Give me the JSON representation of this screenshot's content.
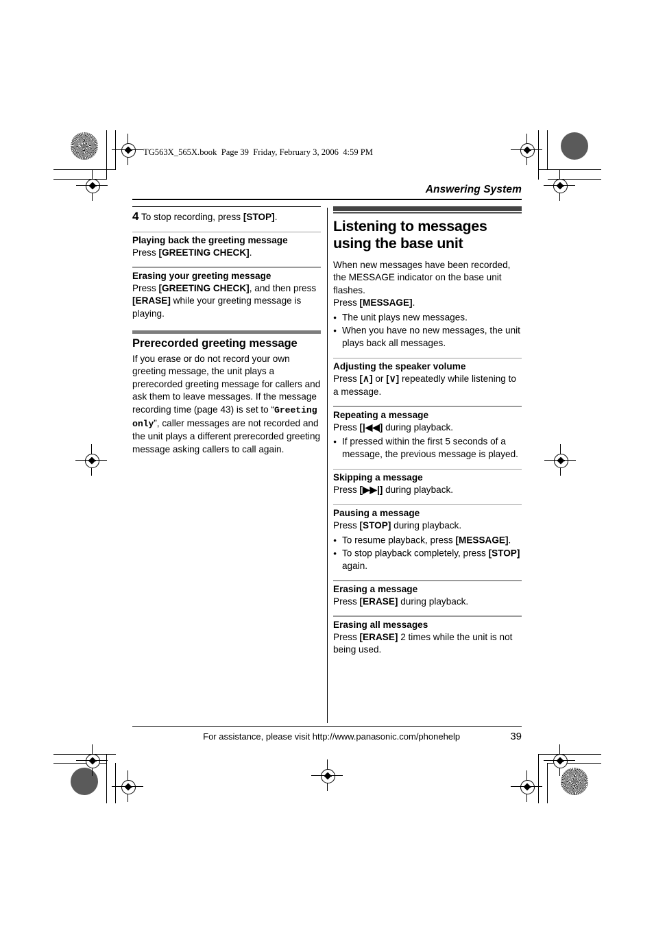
{
  "printing": {
    "file_header": "TG563X_565X.book  Page 39  Friday, February 3, 2006  4:59 PM"
  },
  "running_head": "Answering System",
  "left_column": {
    "step": {
      "number": "4",
      "text_before": "To stop recording, press ",
      "key": "[STOP]",
      "text_after": "."
    },
    "sections": [
      {
        "heading": "Playing back the greeting message",
        "line_1_before": "Press ",
        "line_1_key": "[GREETING CHECK]",
        "line_1_after": "."
      },
      {
        "heading": "Erasing your greeting message",
        "line_1_before": "Press ",
        "line_1_key": "[GREETING CHECK]",
        "line_1_mid": ", and then press ",
        "line_1_key2": "[ERASE]",
        "line_1_after": " while your greeting message is playing."
      }
    ],
    "prerecorded": {
      "heading": "Prerecorded greeting message",
      "para_part1": "If you erase or do not record your own greeting message, the unit plays a prerecorded greeting message for callers and ask them to leave messages. If the message recording time (page 43) is set to “",
      "para_mono": "Greeting only",
      "para_part2": "”, caller messages are not recorded and the unit plays a different prerecorded greeting message asking callers to call again."
    }
  },
  "right_column": {
    "major_heading": "Listening to messages using the base unit",
    "intro_para": "When new messages have been recorded, the MESSAGE indicator on the base unit flashes.",
    "intro_press_before": "Press ",
    "intro_press_key": "[MESSAGE]",
    "intro_press_after": ".",
    "intro_bullets": [
      "The unit plays new messages.",
      "When you have no new messages, the unit plays back all messages."
    ],
    "sections": [
      {
        "heading": "Adjusting the speaker volume",
        "press_before": "Press ",
        "key_1": "[∧]",
        "between": " or ",
        "key_2": "[∨]",
        "press_after": " repeatedly while listening to a message.",
        "bullets": []
      },
      {
        "heading": "Repeating a message",
        "press_before": "Press ",
        "key_1": "[|◀◀]",
        "press_after": " during playback.",
        "bullets": [
          "If pressed within the first 5 seconds of a message, the previous message is played."
        ]
      },
      {
        "heading": "Skipping a message",
        "press_before": "Press ",
        "key_1": "[▶▶|]",
        "press_after": " during playback.",
        "bullets": []
      },
      {
        "heading": "Pausing a message",
        "press_before": "Press ",
        "key_1": "[STOP]",
        "press_after": " during playback.",
        "bullets": [],
        "rich_bullets": [
          {
            "pre": "To resume playback, press ",
            "key": "[MESSAGE]",
            "post": "."
          },
          {
            "pre": "To stop playback completely, press ",
            "key": "[STOP]",
            "post": " again."
          }
        ]
      },
      {
        "heading": "Erasing a message",
        "press_before": "Press ",
        "key_1": "[ERASE]",
        "press_after": " during playback.",
        "bullets": []
      },
      {
        "heading": "Erasing all messages",
        "press_before": "Press ",
        "key_1": "[ERASE]",
        "press_after": " 2 times while the unit is not being used.",
        "bullets": []
      }
    ]
  },
  "footer": {
    "assistance": "For assistance, please visit http://www.panasonic.com/phonehelp",
    "page_number": "39"
  },
  "colors": {
    "major_bar": "#444444",
    "sub_bar": "#7d7d7d",
    "thin_rule": "#9a9a9a",
    "text": "#000000"
  }
}
